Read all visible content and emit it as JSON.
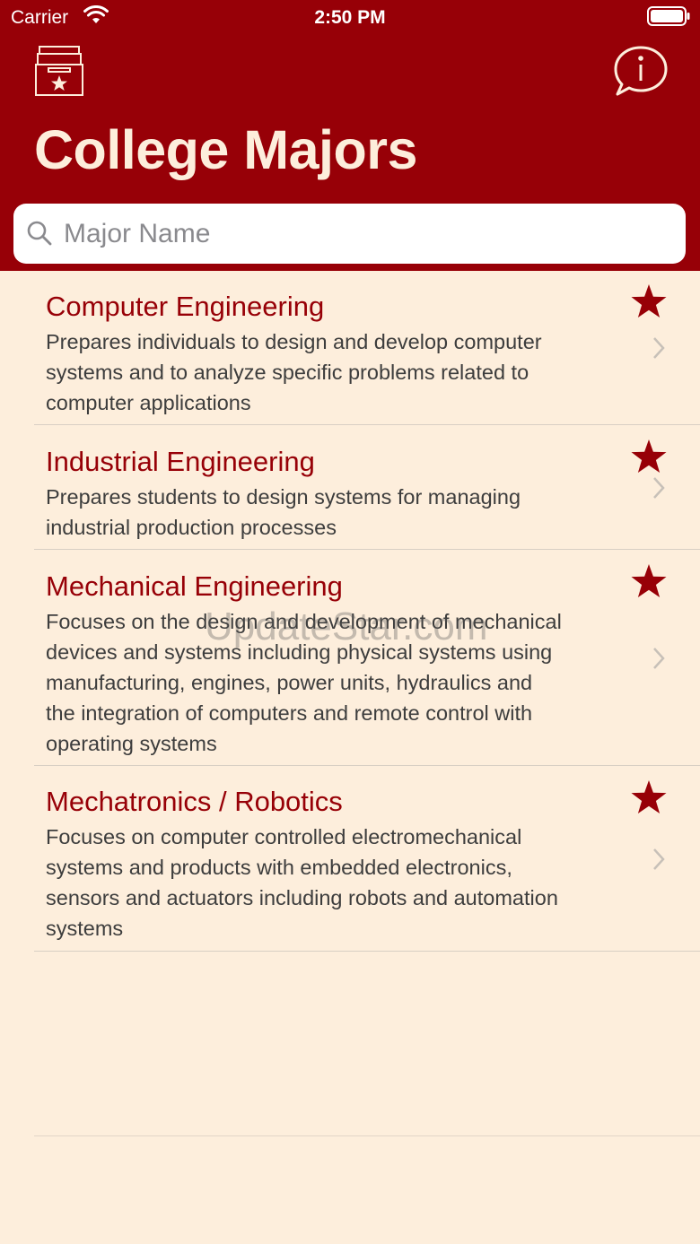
{
  "status_bar": {
    "carrier": "Carrier",
    "time": "2:50 PM"
  },
  "header": {
    "title": "College Majors",
    "left_icon": "favorites-archive-icon",
    "right_icon": "info-bubble-icon"
  },
  "search": {
    "placeholder": "Major Name",
    "value": ""
  },
  "majors": [
    {
      "title": "Computer Engineering",
      "lines": [
        "Prepares individuals to design and develop computer",
        "systems and to analyze specific problems related to",
        "computer applications"
      ]
    },
    {
      "title": "Industrial Engineering",
      "lines": [
        "Prepares students to design systems for managing",
        "industrial production processes"
      ]
    },
    {
      "title": "Mechanical Engineering",
      "lines": [
        "Focuses on the design and development of mechanical",
        "devices and systems including physical systems using",
        "manufacturing, engines, power units, hydraulics and",
        "the integration of computers and remote control with",
        "operating systems"
      ]
    },
    {
      "title": "Mechatronics / Robotics",
      "lines": [
        "Focuses on computer controlled electromechanical",
        "systems and products with embedded electronics,",
        "sensors and actuators including robots and automation",
        "systems"
      ]
    }
  ],
  "watermark": "UpdateStar.com",
  "colors": {
    "brand": "#970007",
    "background": "#fdeedc",
    "title_text": "#fdeedc"
  }
}
